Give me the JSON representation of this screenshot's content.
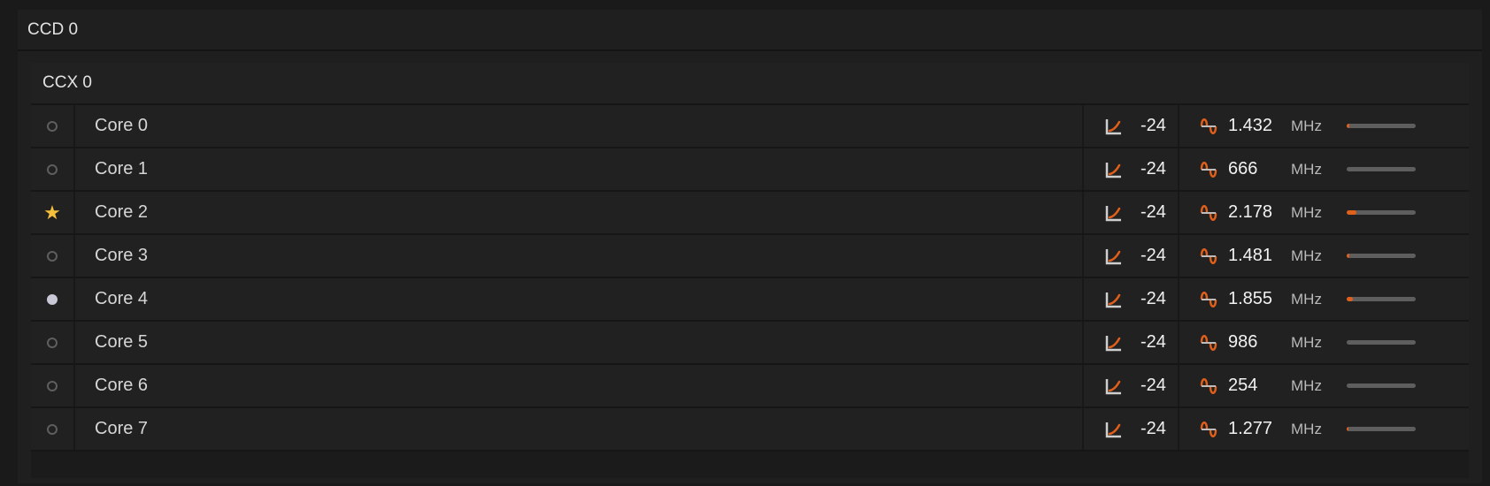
{
  "ccd": {
    "title": "CCD 0"
  },
  "ccx": {
    "title": "CCX 0"
  },
  "colors": {
    "accent": "#e05f1a",
    "star": "#f6c13a",
    "background": "#1a1a1a"
  },
  "cores": [
    {
      "name": "Core 0",
      "indicator": "ring-icon",
      "offset": "-24",
      "frequency": "1.432",
      "unit": "MHz",
      "load": 0.04
    },
    {
      "name": "Core 1",
      "indicator": "ring-icon",
      "offset": "-24",
      "frequency": "666",
      "unit": "MHz",
      "load": 0
    },
    {
      "name": "Core 2",
      "indicator": "star-icon",
      "offset": "-24",
      "frequency": "2.178",
      "unit": "MHz",
      "load": 0.14
    },
    {
      "name": "Core 3",
      "indicator": "ring-icon",
      "offset": "-24",
      "frequency": "1.481",
      "unit": "MHz",
      "load": 0.04
    },
    {
      "name": "Core 4",
      "indicator": "dot-icon",
      "offset": "-24",
      "frequency": "1.855",
      "unit": "MHz",
      "load": 0.09
    },
    {
      "name": "Core 5",
      "indicator": "ring-icon",
      "offset": "-24",
      "frequency": "986",
      "unit": "MHz",
      "load": 0
    },
    {
      "name": "Core 6",
      "indicator": "ring-icon",
      "offset": "-24",
      "frequency": "254",
      "unit": "MHz",
      "load": 0
    },
    {
      "name": "Core 7",
      "indicator": "ring-icon",
      "offset": "-24",
      "frequency": "1.277",
      "unit": "MHz",
      "load": 0.02
    }
  ]
}
